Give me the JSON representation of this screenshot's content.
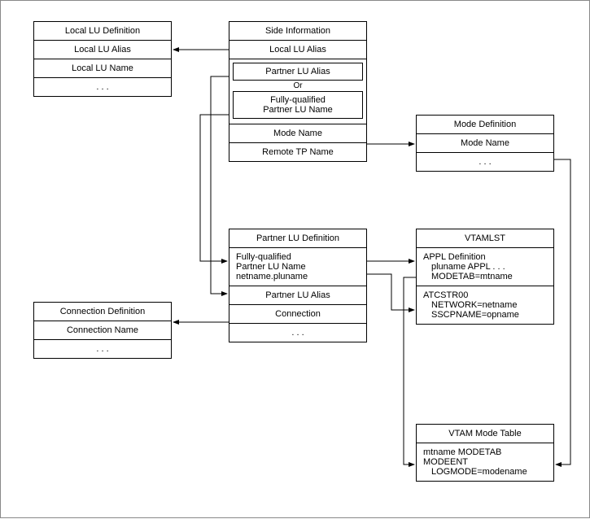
{
  "chart_data": {
    "type": "diagram",
    "nodes": [
      {
        "id": "local_lu",
        "title": "Local LU Definition",
        "rows": [
          "Local LU Alias",
          "Local LU Name",
          ". . ."
        ]
      },
      {
        "id": "side_info",
        "title": "Side Information",
        "rows": [
          "Local LU Alias",
          "Partner LU Alias",
          "Or",
          "Fully-qualified Partner LU Name",
          "Mode Name",
          "Remote TP Name"
        ]
      },
      {
        "id": "mode_def",
        "title": "Mode Definition",
        "rows": [
          "Mode Name",
          ". . ."
        ]
      },
      {
        "id": "partner_lu",
        "title": "Partner LU Definition",
        "rows": [
          "Fully-qualified Partner LU Name netname.pluname",
          "Partner LU Alias",
          "Connection",
          ". . ."
        ]
      },
      {
        "id": "vtamlst",
        "title": "VTAMLST",
        "rows": [
          "APPL Definition  pluname APPL . . .  MODETAB=mtname",
          "ATCSTR00  NETWORK=netname  SSCPNAME=opname"
        ]
      },
      {
        "id": "conn_def",
        "title": "Connection Definition",
        "rows": [
          "Connection Name",
          ". . ."
        ]
      },
      {
        "id": "vtam_mode",
        "title": "VTAM Mode Table",
        "rows": [
          "mtname MODETAB MODEENT  LOGMODE=modename"
        ]
      }
    ],
    "edges": [
      {
        "from": "side_info.Local LU Alias",
        "to": "local_lu"
      },
      {
        "from": "side_info.Partner LU Alias",
        "to": "partner_lu.Partner LU Alias"
      },
      {
        "from": "side_info.Fully-qualified Partner LU Name",
        "to": "partner_lu.Fully-qualified"
      },
      {
        "from": "side_info.Mode Name",
        "to": "mode_def"
      },
      {
        "from": "partner_lu.Fully-qualified",
        "to": "vtamlst.APPL"
      },
      {
        "from": "partner_lu.netname",
        "to": "vtamlst.ATCSTR00"
      },
      {
        "from": "partner_lu.Connection",
        "to": "conn_def"
      },
      {
        "from": "mode_def",
        "to": "vtam_mode"
      },
      {
        "from": "vtamlst.MODETAB",
        "to": "vtam_mode"
      }
    ]
  },
  "local_lu": {
    "title": "Local LU Definition",
    "r1": "Local LU Alias",
    "r2": "Local LU Name",
    "r3": ". . ."
  },
  "side_info": {
    "title": "Side Information",
    "r1": "Local LU Alias",
    "inner1": "Partner LU Alias",
    "or": "Or",
    "inner2a": "Fully-qualified",
    "inner2b": "Partner LU Name",
    "r4": "Mode Name",
    "r5": "Remote TP Name"
  },
  "mode_def": {
    "title": "Mode Definition",
    "r1": "Mode Name",
    "r2": ". . ."
  },
  "partner_lu": {
    "title": "Partner LU Definition",
    "r1a": "Fully-qualified",
    "r1b": "Partner LU Name",
    "r1c": "netname.pluname",
    "r2": "Partner LU Alias",
    "r3": "Connection",
    "r4": ". . ."
  },
  "vtamlst": {
    "title": "VTAMLST",
    "b1a": "APPL Definition",
    "b1b": "pluname APPL . . .",
    "b1c": "MODETAB=mtname",
    "b2a": "ATCSTR00",
    "b2b": "NETWORK=netname",
    "b2c": "SSCPNAME=opname"
  },
  "conn_def": {
    "title": "Connection Definition",
    "r1": "Connection Name",
    "r2": ". . ."
  },
  "vtam_mode": {
    "title": "VTAM Mode Table",
    "r1a": "mtname MODETAB",
    "r1b": "MODEENT",
    "r1c": "LOGMODE=modename"
  }
}
